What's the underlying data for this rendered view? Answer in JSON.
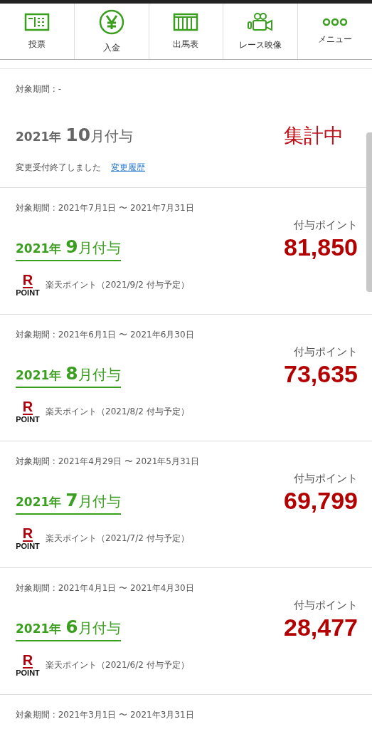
{
  "nav": [
    {
      "kind": "ticket",
      "label": "投票"
    },
    {
      "kind": "yen",
      "label": "入金"
    },
    {
      "kind": "table",
      "label": "出馬表"
    },
    {
      "kind": "camera",
      "label": "レース映像"
    },
    {
      "kind": "dots",
      "label": "メニュー"
    }
  ],
  "entries": [
    {
      "kind": "pending",
      "period": "対象期間 : -",
      "title_year": "2021年",
      "title_month": "10",
      "title_suffix": "月付与",
      "status": "集計中",
      "note": "変更受付終了しました",
      "link": "変更履歴"
    },
    {
      "kind": "granted",
      "period": "対象期間 : 2021年7月1日 〜 2021年7月31日",
      "points_label": "付与ポイント",
      "title_year": "2021年",
      "title_month": "9",
      "title_suffix": "月付与",
      "amount": "81,850",
      "logo_mark": "R",
      "logo_text": "POINT",
      "point_note": "楽天ポイント（2021/9/2 付与予定）"
    },
    {
      "kind": "granted",
      "period": "対象期間 : 2021年6月1日 〜 2021年6月30日",
      "points_label": "付与ポイント",
      "title_year": "2021年",
      "title_month": "8",
      "title_suffix": "月付与",
      "amount": "73,635",
      "logo_mark": "R",
      "logo_text": "POINT",
      "point_note": "楽天ポイント（2021/8/2 付与予定）"
    },
    {
      "kind": "granted",
      "period": "対象期間 : 2021年4月29日 〜 2021年5月31日",
      "points_label": "付与ポイント",
      "title_year": "2021年",
      "title_month": "7",
      "title_suffix": "月付与",
      "amount": "69,799",
      "logo_mark": "R",
      "logo_text": "POINT",
      "point_note": "楽天ポイント（2021/7/2 付与予定）"
    },
    {
      "kind": "granted",
      "period": "対象期間 : 2021年4月1日 〜 2021年4月30日",
      "points_label": "付与ポイント",
      "title_year": "2021年",
      "title_month": "6",
      "title_suffix": "月付与",
      "amount": "28,477",
      "logo_mark": "R",
      "logo_text": "POINT",
      "point_note": "楽天ポイント（2021/6/2 付与予定）"
    },
    {
      "kind": "partial",
      "period": "対象期間 : 2021年3月1日 〜 2021年3月31日"
    }
  ]
}
